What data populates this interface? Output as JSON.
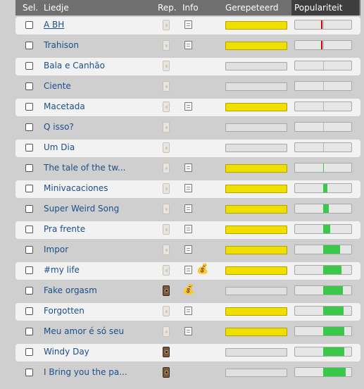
{
  "header": {
    "sel": "Sel.",
    "liedje": "Liedje",
    "rep": "Rep.",
    "info": "Info",
    "gerepeteerd": "Gerepeteerd",
    "populariteit": "Populariteit"
  },
  "rows": [
    {
      "title": "A BH",
      "link": true,
      "rep": "pale",
      "info": true,
      "money": false,
      "repeated": true,
      "popularity": -0.04
    },
    {
      "title": "Trahison",
      "link": false,
      "rep": "pale",
      "info": true,
      "money": false,
      "repeated": true,
      "popularity": -0.04
    },
    {
      "title": "Bala e Canhão",
      "link": false,
      "rep": "pale",
      "info": false,
      "money": false,
      "repeated": false,
      "popularity": 0
    },
    {
      "title": "Ciente",
      "link": false,
      "rep": "pale",
      "info": false,
      "money": false,
      "repeated": false,
      "popularity": 0
    },
    {
      "title": "Macetada",
      "link": false,
      "rep": "pale",
      "info": true,
      "money": false,
      "repeated": true,
      "popularity": 0
    },
    {
      "title": "Q isso?",
      "link": false,
      "rep": "pale",
      "info": false,
      "money": false,
      "repeated": false,
      "popularity": 0
    },
    {
      "title": "Um Dia",
      "link": false,
      "rep": "pale",
      "info": false,
      "money": false,
      "repeated": false,
      "popularity": 0
    },
    {
      "title": "The tale of the tw...",
      "link": false,
      "rep": "pale",
      "info": true,
      "money": false,
      "repeated": true,
      "popularity": 0.01
    },
    {
      "title": "Minivacaciones",
      "link": false,
      "rep": "pale",
      "info": true,
      "money": false,
      "repeated": true,
      "popularity": 0.07
    },
    {
      "title": "Super Weird Song",
      "link": false,
      "rep": "pale",
      "info": true,
      "money": false,
      "repeated": true,
      "popularity": 0.1
    },
    {
      "title": "Pra frente",
      "link": false,
      "rep": "pale",
      "info": true,
      "money": false,
      "repeated": true,
      "popularity": 0.12
    },
    {
      "title": "Impor",
      "link": false,
      "rep": "pale",
      "info": true,
      "money": false,
      "repeated": true,
      "popularity": 0.3
    },
    {
      "title": "#my life",
      "link": false,
      "rep": "pale",
      "info": true,
      "money": true,
      "repeated": true,
      "popularity": 0.33
    },
    {
      "title": "Fake orgasm",
      "link": false,
      "rep": "dark",
      "info": false,
      "money": true,
      "repeated": false,
      "popularity": 0.35
    },
    {
      "title": "Forgotten",
      "link": false,
      "rep": "pale",
      "info": true,
      "money": false,
      "repeated": true,
      "popularity": 0.36
    },
    {
      "title": "Meu amor é só seu",
      "link": false,
      "rep": "pale",
      "info": true,
      "money": false,
      "repeated": true,
      "popularity": 0.37
    },
    {
      "title": "Windy Day",
      "link": false,
      "rep": "dark",
      "info": false,
      "money": false,
      "repeated": false,
      "popularity": 0.38
    },
    {
      "title": "I Bring you the pa...",
      "link": false,
      "rep": "dark",
      "info": false,
      "money": false,
      "repeated": false,
      "popularity": 0.4
    }
  ]
}
